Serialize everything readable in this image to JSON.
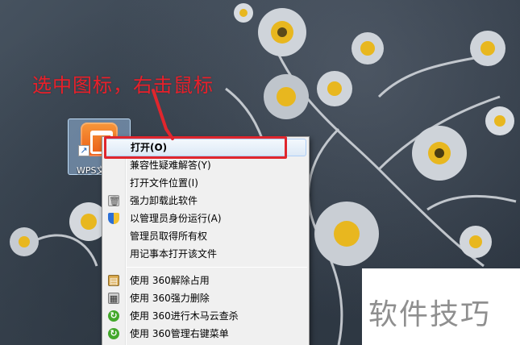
{
  "annotation": {
    "caption": "选中图标，右击鼠标",
    "color": "#e0262d"
  },
  "desktop_icon": {
    "label": "WPS文",
    "icon": "wps-app-icon",
    "overlay": "shortcut-arrow-icon"
  },
  "context_menu": {
    "groups": [
      {
        "items": [
          {
            "label": "打开(O)",
            "highlighted": true,
            "icon": null
          },
          {
            "label": "兼容性疑难解答(Y)",
            "icon": null
          },
          {
            "label": "打开文件位置(I)",
            "icon": null
          },
          {
            "label": "强力卸载此软件",
            "icon": "trash-icon"
          },
          {
            "label": "以管理员身份运行(A)",
            "icon": "uac-shield-icon"
          },
          {
            "label": "管理员取得所有权",
            "icon": null
          },
          {
            "label": "用记事本打开该文件",
            "icon": null
          }
        ]
      },
      {
        "items": [
          {
            "label": "使用 360解除占用",
            "icon": "360-unlock-icon"
          },
          {
            "label": "使用 360强力删除",
            "icon": "360-shred-icon"
          },
          {
            "label": "使用 360进行木马云查杀",
            "icon": "360-scan-icon"
          },
          {
            "label": "使用 360管理右键菜单",
            "icon": "360-menu-icon"
          }
        ]
      }
    ]
  },
  "watermark": {
    "text": "软件技巧"
  }
}
